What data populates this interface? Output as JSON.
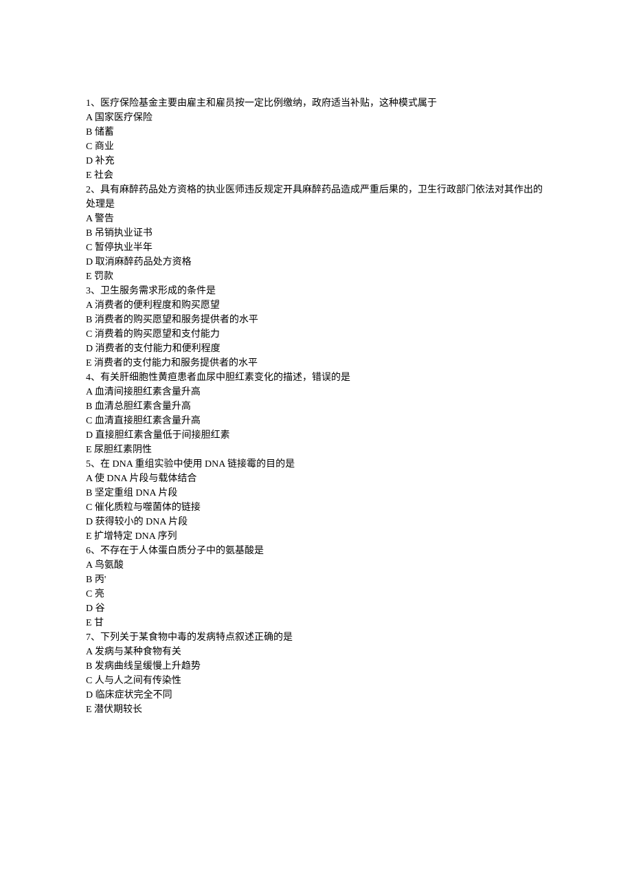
{
  "questions": [
    {
      "stem": "1、医疗保险基金主要由雇主和雇员按一定比例缴纳，政府适当补贴，这种模式属于",
      "options": [
        "A 国家医疗保险",
        "B 储蓄",
        "C 商业",
        "D 补充",
        "E 社会"
      ]
    },
    {
      "stem": "2、具有麻醉药品处方资格的执业医师违反规定开具麻醉药品造成严重后果的，卫生行政部门依法对其作出的处理是",
      "options": [
        "A 警告",
        "B 吊销执业证书",
        "C 暂停执业半年",
        "D 取消麻醉药品处方资格",
        "E 罚款"
      ]
    },
    {
      "stem": "3、卫生服务需求形成的条件是",
      "options": [
        "A 消费者的便利程度和购买愿望",
        "B 消费者的购买愿望和服务提供者的水平",
        "C 消费着的购买愿望和支付能力",
        "D 消费者的支付能力和便利程度",
        "E 消费者的支付能力和服务提供者的水平"
      ]
    },
    {
      "stem": "4、有关肝细胞性黄疸患者血尿中胆红素变化的描述，错误的是",
      "options": [
        "A 血清间接胆红素含量升高",
        "B 血清总胆红素含量升高",
        "C  血清直接胆红素含量升高",
        "D 直接胆红素含量低于间接胆红素",
        "E 尿胆红素阴性"
      ]
    },
    {
      "stem": "5、在 DNA 重组实验中使用 DNA 链接霉的目的是",
      "options": [
        "A 使 DNA 片段与载体结合",
        "B  坚定重组 DNA 片段",
        "C 催化质粒与噬菌体的链接",
        "D 获得较小的 DNA 片段",
        "E 扩增特定 DNA 序列"
      ]
    },
    {
      "stem": "6、不存在于人体蛋白质分子中的氨基酸是",
      "options": [
        "A 鸟氨酸",
        "B 丙'",
        "C 亮",
        "D 谷",
        "E 甘"
      ]
    },
    {
      "stem": "7、下列关于某食物中毒的发病特点叙述正确的是",
      "options": [
        "A 发病与某种食物有关",
        "B 发病曲线呈缓慢上升趋势",
        "C 人与人之间有传染性",
        "D 临床症状完全不同",
        "E 潜伏期较长"
      ]
    }
  ]
}
